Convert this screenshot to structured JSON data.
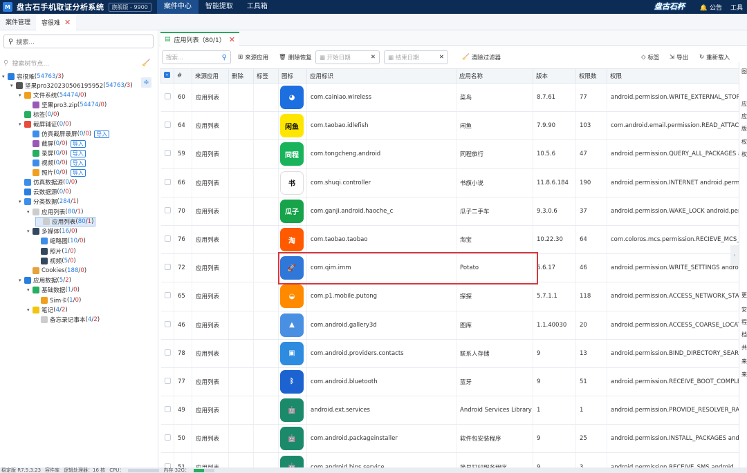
{
  "app": {
    "logo": "M",
    "title": "盘古石手机取证分析系统",
    "edition": "旗舰版 - 9900",
    "nav": [
      "案件中心",
      "智能提取",
      "工具箱"
    ],
    "brand": "盘古石杯",
    "announce": "公告",
    "tools": "工具"
  },
  "subtabs": [
    {
      "label": "案件管理"
    },
    {
      "label": "容很难"
    }
  ],
  "left": {
    "search_placeholder": "搜索...",
    "tree_search_placeholder": "搜索树节点...",
    "tree": [
      {
        "text": "容很难",
        "count": "54763",
        "err": "3",
        "indent": 0,
        "caret": "▾",
        "color": "#2a7ee0"
      },
      {
        "text": "坚果pro320230506195952",
        "count": "54763",
        "err": "3",
        "indent": 1,
        "caret": "▾",
        "color": "#555555"
      },
      {
        "text": "文件系统",
        "count": "54474",
        "err": "0",
        "indent": 2,
        "caret": "▾",
        "color": "#f0a020"
      },
      {
        "text": "坚果pro3.zip",
        "count": "54474",
        "err": "0",
        "indent": 3,
        "caret": "",
        "color": "#9b59b6"
      },
      {
        "text": "标签",
        "count": "0",
        "err": "0",
        "indent": 2,
        "caret": "",
        "color": "#27ae60"
      },
      {
        "text": "截屏辅证",
        "count": "0",
        "err": "0",
        "indent": 2,
        "caret": "▾",
        "color": "#e74c3c"
      },
      {
        "text": "仿真截屏录屏",
        "count": "0",
        "err": "0",
        "indent": 3,
        "caret": "",
        "color": "#3d8eea",
        "import": "导入"
      },
      {
        "text": "截屏",
        "count": "0",
        "err": "0",
        "indent": 3,
        "caret": "",
        "color": "#9b59b6",
        "import": "导入"
      },
      {
        "text": "录屏",
        "count": "0",
        "err": "0",
        "indent": 3,
        "caret": "",
        "color": "#27ae60",
        "import": "导入"
      },
      {
        "text": "视频",
        "count": "0",
        "err": "0",
        "indent": 3,
        "caret": "",
        "color": "#3d8eea",
        "import": "导入"
      },
      {
        "text": "照片",
        "count": "0",
        "err": "0",
        "indent": 3,
        "caret": "",
        "color": "#f0a020",
        "import": "导入"
      },
      {
        "text": "仿真数据源",
        "count": "0",
        "err": "0",
        "indent": 2,
        "caret": "",
        "color": "#3d8eea"
      },
      {
        "text": "云数据源",
        "count": "0",
        "err": "0",
        "indent": 2,
        "caret": "",
        "color": "#2a7ee0"
      },
      {
        "text": "分类数据",
        "count": "284",
        "err": "1",
        "indent": 2,
        "caret": "▾",
        "color": "#3d8eea"
      },
      {
        "text": "应用列表",
        "count": "80",
        "err": "1",
        "indent": 3,
        "caret": "▾",
        "color": "#cccccc"
      },
      {
        "text": "应用列表",
        "count": "80",
        "err": "1",
        "indent": 4,
        "caret": "",
        "color": "#cccccc",
        "selected": true
      },
      {
        "text": "多媒体",
        "count": "16",
        "err": "0",
        "indent": 3,
        "caret": "▾",
        "color": "#34495e"
      },
      {
        "text": "缩略图",
        "count": "10",
        "err": "0",
        "indent": 4,
        "caret": "",
        "color": "#3d8eea"
      },
      {
        "text": "照片",
        "count": "1",
        "err": "0",
        "indent": 4,
        "caret": "",
        "color": "#34495e"
      },
      {
        "text": "视频",
        "count": "5",
        "err": "0",
        "indent": 4,
        "caret": "",
        "color": "#34495e"
      },
      {
        "text": "Cookies",
        "count": "188",
        "err": "0",
        "indent": 3,
        "caret": "",
        "color": "#e6a23c"
      },
      {
        "text": "应用数据",
        "count": "5",
        "err": "2",
        "indent": 2,
        "caret": "▾",
        "color": "#2a7ee0"
      },
      {
        "text": "基础数据",
        "count": "1",
        "err": "0",
        "indent": 3,
        "caret": "▾",
        "color": "#27ae60"
      },
      {
        "text": "Sim卡",
        "count": "1",
        "err": "0",
        "indent": 4,
        "caret": "",
        "color": "#f0a020"
      },
      {
        "text": "笔记",
        "count": "4",
        "err": "2",
        "indent": 3,
        "caret": "▾",
        "color": "#f1c40f"
      },
      {
        "text": "备忘录记事本",
        "count": "4",
        "err": "2",
        "indent": 4,
        "caret": "",
        "color": "#cccccc"
      }
    ]
  },
  "main": {
    "tab_label": "应用列表（80/1）",
    "toolbar": {
      "search_placeholder": "搜索...",
      "source_app": "来源应用",
      "delete_restore": "删除恢复",
      "start_date": "开始日期",
      "end_date": "结束日期",
      "clear_filter": "清除过滤器",
      "tag": "标签",
      "export": "导出",
      "reload": "重新载入"
    },
    "columns": [
      "#",
      "来源应用",
      "删除",
      "标签",
      "图标",
      "应用标识",
      "应用名称",
      "版本",
      "权限数",
      "权限"
    ],
    "rows": [
      {
        "id": "60",
        "src": "应用列表",
        "pkg": "com.cainiao.wireless",
        "name": "菜鸟",
        "ver": "8.7.61",
        "pcount": "77",
        "perm": "android.permission.WRITE_EXTERNAL_STORAGE",
        "icon": "cainiao"
      },
      {
        "id": "64",
        "src": "应用列表",
        "pkg": "com.taobao.idlefish",
        "name": "闲鱼",
        "ver": "7.9.90",
        "pcount": "103",
        "perm": "com.android.email.permission.READ_ATTACHMENT",
        "icon": "xianyu"
      },
      {
        "id": "59",
        "src": "应用列表",
        "pkg": "com.tongcheng.android",
        "name": "同程旅行",
        "ver": "10.5.6",
        "pcount": "47",
        "perm": "android.permission.QUERY_ALL_PACKAGES  and",
        "icon": "tongcheng"
      },
      {
        "id": "66",
        "src": "应用列表",
        "pkg": "com.shuqi.controller",
        "name": "书旗小说",
        "ver": "11.8.6.184",
        "pcount": "190",
        "perm": "android.permission.INTERNET  android.permiss",
        "icon": "shuqi"
      },
      {
        "id": "70",
        "src": "应用列表",
        "pkg": "com.ganji.android.haoche_c",
        "name": "瓜子二手车",
        "ver": "9.3.0.6",
        "pcount": "37",
        "perm": "android.permission.WAKE_LOCK  android.perm",
        "icon": "guazi"
      },
      {
        "id": "76",
        "src": "应用列表",
        "pkg": "com.taobao.taobao",
        "name": "淘宝",
        "ver": "10.22.30",
        "pcount": "64",
        "perm": "com.coloros.mcs.permission.RECIEVE_MCS_ME",
        "icon": "taobao"
      },
      {
        "id": "72",
        "src": "应用列表",
        "pkg": "com.qim.imm",
        "name": "Potato",
        "ver": "5.6.17",
        "pcount": "46",
        "perm": "android.permission.WRITE_SETTINGS  andro",
        "icon": "potato"
      },
      {
        "id": "65",
        "src": "应用列表",
        "pkg": "com.p1.mobile.putong",
        "name": "探探",
        "ver": "5.7.1.1",
        "pcount": "118",
        "perm": "android.permission.ACCESS_NETWORK_STATE  a",
        "icon": "tantan"
      },
      {
        "id": "46",
        "src": "应用列表",
        "pkg": "com.android.gallery3d",
        "name": "图库",
        "ver": "1.1.40030",
        "pcount": "20",
        "perm": "android.permission.ACCESS_COARSE_LOCATIO",
        "icon": "gallery"
      },
      {
        "id": "78",
        "src": "应用列表",
        "pkg": "com.android.providers.contacts",
        "name": "联系人存储",
        "ver": "9",
        "pcount": "13",
        "perm": "android.permission.BIND_DIRECTORY_SEARCH",
        "icon": "contacts"
      },
      {
        "id": "77",
        "src": "应用列表",
        "pkg": "com.android.bluetooth",
        "name": "蓝牙",
        "ver": "9",
        "pcount": "51",
        "perm": "android.permission.RECEIVE_BOOT_COMPLETE",
        "icon": "bluetooth"
      },
      {
        "id": "49",
        "src": "应用列表",
        "pkg": "android.ext.services",
        "name": "Android Services Library",
        "ver": "1",
        "pcount": "1",
        "perm": "android.permission.PROVIDE_RESOLVER_RANK",
        "icon": "android"
      },
      {
        "id": "50",
        "src": "应用列表",
        "pkg": "com.android.packageinstaller",
        "name": "软件包安装程序",
        "ver": "9",
        "pcount": "25",
        "perm": "android.permission.INSTALL_PACKAGES  andro",
        "icon": "android"
      },
      {
        "id": "51",
        "src": "应用列表",
        "pkg": "com.android.bips.service",
        "name": "简易打印服务程序",
        "ver": "9",
        "pcount": "3",
        "perm": "android.permission.RECEIVE_SMS  android",
        "icon": "android"
      }
    ]
  },
  "side_panel": [
    "图",
    "应",
    "应",
    "版",
    "权",
    "权",
    "更",
    "安",
    "程",
    "档",
    "共",
    "来",
    "来"
  ],
  "status": {
    "text1": "稳定版 R7.5.3.23",
    "text2": "容件库",
    "text3": "逻辑处理器：16 核",
    "text4": "CPU：",
    "text5": "内存 32G："
  }
}
